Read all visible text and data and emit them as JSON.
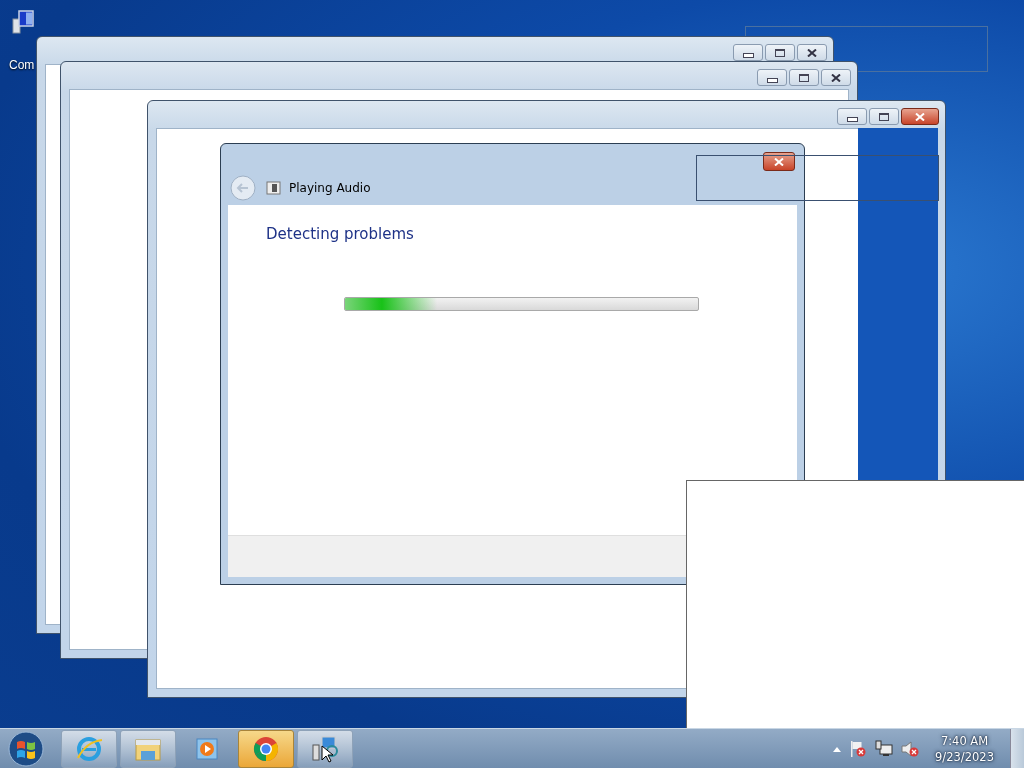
{
  "desktop_icon": {
    "label": "Com"
  },
  "dialog": {
    "title": "Playing Audio",
    "heading": "Detecting problems",
    "progress": {
      "level": 0.26
    }
  },
  "taskbar": {
    "items": [
      {
        "kind": "ie",
        "running": true,
        "selected": false
      },
      {
        "kind": "explorer",
        "running": true,
        "selected": false
      },
      {
        "kind": "media",
        "running": false,
        "selected": false
      },
      {
        "kind": "chrome",
        "running": true,
        "selected": true
      },
      {
        "kind": "network",
        "running": true,
        "selected": false
      }
    ],
    "tray": [
      {
        "kind": "flag"
      },
      {
        "kind": "network"
      },
      {
        "kind": "speaker"
      }
    ],
    "clock": {
      "time": "7:40 AM",
      "date": "9/23/2023"
    }
  }
}
